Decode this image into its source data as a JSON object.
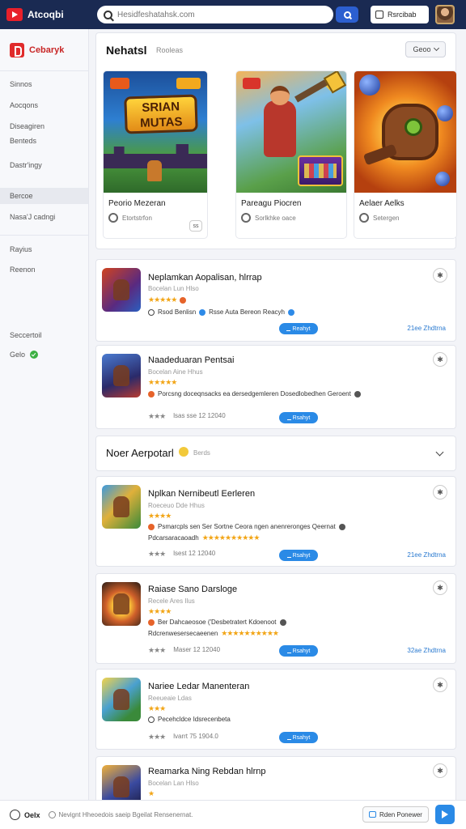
{
  "app": {
    "title": "Atcoqbi"
  },
  "search": {
    "placeholder": "Hesidfeshatahsk.com"
  },
  "header": {
    "account_label": "Rsrcibab"
  },
  "sidebar": {
    "brand": "Cebaryk",
    "items": [
      {
        "label": "Sinnos"
      },
      {
        "label": "Aocqons"
      },
      {
        "label": "Diseagiren"
      },
      {
        "label": "Benteds"
      },
      {
        "label": "Dastr'ingy"
      },
      {
        "label": "Bercoe"
      },
      {
        "label": "Nasa'J cadngi"
      },
      {
        "label": "Rayius"
      },
      {
        "label": "Reenon"
      },
      {
        "label": "Seccertoil"
      },
      {
        "label": "Gelo"
      }
    ]
  },
  "featured": {
    "title": "Nehatsl",
    "subtitle": "Rooleas",
    "sort_label": "Geoo",
    "art1_text": "SRIAN\nMUTAS",
    "items": [
      {
        "name": "Peorio Mezeran",
        "meta": "Etortstrfon",
        "btn": "ss"
      },
      {
        "name": "Pareagu Piocren",
        "meta": "Sorlkhke oace"
      },
      {
        "name": "Aelaer Aelks",
        "meta": "Setergen"
      }
    ]
  },
  "list1": [
    {
      "title": "Neplamkan Aopalisan, hlrrap",
      "sub": "Bocelan Lun Hlso",
      "line1": "Rsod Benlisn",
      "line1b": "Rsse Auta Bereon Reacyh",
      "stars": "★★★★★",
      "install": "Reahyt",
      "link": "21ee Zhdtrna"
    },
    {
      "title": "Naadeduaran Pentsai",
      "sub": "Bocelan Aine Hhus",
      "stars": "★★★★★",
      "line1": "Porcsng doceqnsacks ea dersedgemleren Dosedlobedhen Geroent",
      "line1b": "",
      "rating": "★★★",
      "meta": "lsas sse 12 12040",
      "install": "Rsahyt"
    }
  ],
  "section": {
    "title": "Noer Aerpotarl",
    "sub": "Berds"
  },
  "list2": [
    {
      "title": "Nplkan Nernibeutl Eerleren",
      "sub": "Roeceuo Dde Hhus",
      "stars": "★★★★",
      "line1": "Psmarcpls sen Ser Sortne Ceora ngen anenreronges Qeernat",
      "line1b": "",
      "line2": "Pdcarsaracaoadh",
      "rating": "★★★",
      "meta": "lsest 12 12040",
      "install": "Rsahyt",
      "link": "21ee Zhdtrna"
    },
    {
      "title": "Raiase Sano Darsloge",
      "sub": "Recele Ares Ilus",
      "stars": "★★★★",
      "line1": "Ber Dahcaeosoe ('Desbetratert Kdoenoot",
      "line1b": "",
      "line2": "Rdcrenwesersecaeenen",
      "rating": "★★★",
      "meta": "Maser 12 12040",
      "install": "Rsahyt",
      "link": "32ae Zhdtrna"
    },
    {
      "title": "Nariee Ledar Manenteran",
      "sub": "Reeueaie Ldas",
      "stars": "★★★",
      "line1": "Pecehcldce Idsrecenbeta",
      "line1b": "",
      "rating": "★★★",
      "meta": "lvarrt 75 1904.0",
      "install": "Rsahyt"
    },
    {
      "title": "Reamarka Ning Rebdan hlrnp",
      "sub": "Bocelan Lan Hlso",
      "stars": "★",
      "line1": "",
      "line1b": ""
    }
  ],
  "bottom": {
    "help_label": "Oelx",
    "info": "Nevignt Hheoedois saeip Bgeilat Rensenernat.",
    "chat_label": "Rden Ponewer"
  }
}
